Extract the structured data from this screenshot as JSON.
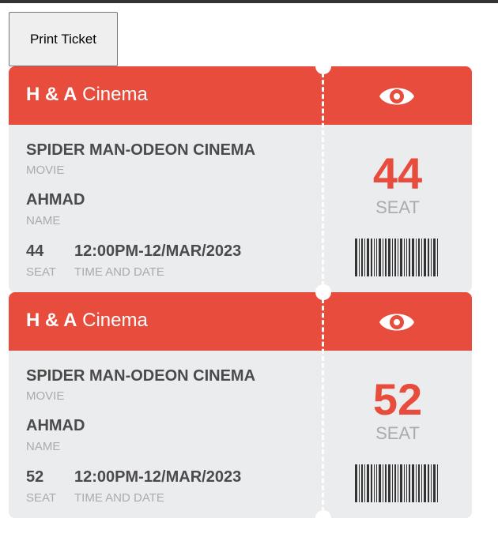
{
  "page": {
    "print_button_label": "Print Ticket"
  },
  "tickets": [
    {
      "brand_bold": "H & A",
      "brand_light": "Cinema",
      "icon": "eye-icon",
      "movie": "SPIDER MAN-ODEON CINEMA",
      "movie_label": "MOVIE",
      "name": "AHMAD",
      "name_label": "NAME",
      "seat": "44",
      "seat_label": "SEAT",
      "datetime": "12:00PM-12/MAR/2023",
      "datetime_label": "TIME AND DATE",
      "seat_big": "44",
      "seat_word": "SEAT"
    },
    {
      "brand_bold": "H & A",
      "brand_light": "Cinema",
      "icon": "eye-icon",
      "movie": "SPIDER MAN-ODEON CINEMA",
      "movie_label": "MOVIE",
      "name": "AHMAD",
      "name_label": "NAME",
      "seat": "52",
      "seat_label": "SEAT",
      "datetime": "12:00PM-12/MAR/2023",
      "datetime_label": "TIME AND DATE",
      "seat_big": "52",
      "seat_word": "SEAT"
    }
  ],
  "colors": {
    "accent": "#e84c3d",
    "card": "#ebecee",
    "text": "#4a4a4a",
    "muted": "#a7acaf"
  }
}
